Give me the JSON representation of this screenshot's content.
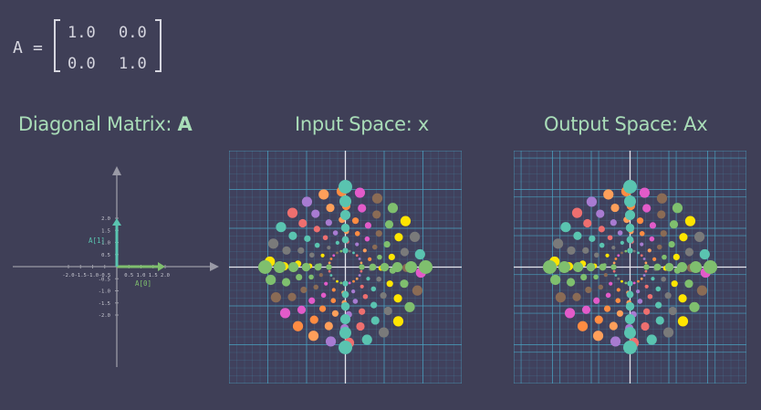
{
  "matrix": {
    "name": "A",
    "equals": "=",
    "rows": [
      [
        "1.0",
        "0.0"
      ],
      [
        "0.0",
        "1.0"
      ]
    ]
  },
  "titles": {
    "diagonal_prefix": "Diagonal Matrix: ",
    "diagonal_var": "A",
    "input": "Input Space: x",
    "output": "Output Space: Ax"
  },
  "axes": {
    "ticks": [
      -2.0,
      -1.5,
      -1.0,
      -0.5,
      0.5,
      1.0,
      1.5,
      2.0
    ],
    "tick_labels": [
      "-2.0",
      "-1.5",
      "-1.0",
      "-0.5",
      "0.5",
      "1.0",
      "1.5",
      "2.0"
    ],
    "range": [
      -2.0,
      2.0
    ],
    "vectors": [
      {
        "label": "A[0]",
        "x": 1.0,
        "y": 0.0,
        "color": "#7fbf6e"
      },
      {
        "label": "A[1]",
        "x": 0.0,
        "y": 1.0,
        "color": "#5ac4b0"
      }
    ]
  },
  "colors": {
    "background": "#3f3f57",
    "grid": "#4aa3c2",
    "axis": "#d7d7e0",
    "title": "#a9ddb8",
    "dot_palette": [
      "#5ac4b0",
      "#7fbf6e",
      "#ff8c42",
      "#ee6f6f",
      "#ffe500",
      "#e25bc9",
      "#a87bd1",
      "#7a7a7a",
      "#8a6b55",
      "#ff9f5a"
    ]
  }
}
